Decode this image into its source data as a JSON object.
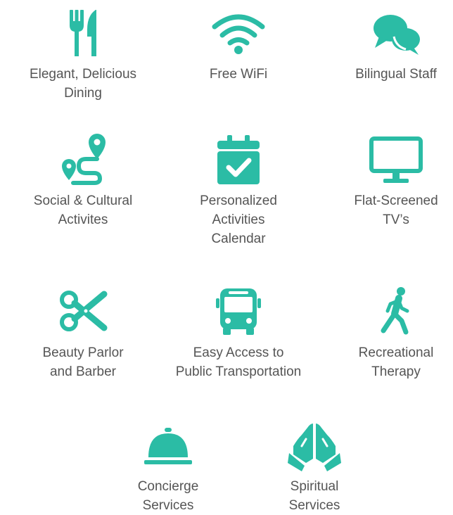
{
  "accent_color": "#2bbca5",
  "text_color": "#555555",
  "amenities": [
    {
      "label": "Elegant, Delicious\nDining",
      "icon": "fork-knife-icon"
    },
    {
      "label": "Free WiFi",
      "icon": "wifi-icon"
    },
    {
      "label": "Bilingual Staff",
      "icon": "speech-bubbles-icon"
    },
    {
      "label": "Social & Cultural\nActivites",
      "icon": "route-icon"
    },
    {
      "label": "Personalized\nActivities\nCalendar",
      "icon": "calendar-check-icon"
    },
    {
      "label": "Flat-Screened\nTV’s",
      "icon": "tv-icon"
    },
    {
      "label": "Beauty Parlor\nand Barber",
      "icon": "scissors-icon"
    },
    {
      "label": "Easy Access to\nPublic Transportation",
      "icon": "bus-icon"
    },
    {
      "label": "Recreational\nTherapy",
      "icon": "walking-person-icon"
    },
    {
      "label": "Concierge\nServices",
      "icon": "service-bell-icon"
    },
    {
      "label": "Spiritual\nServices",
      "icon": "praying-hands-icon"
    }
  ]
}
